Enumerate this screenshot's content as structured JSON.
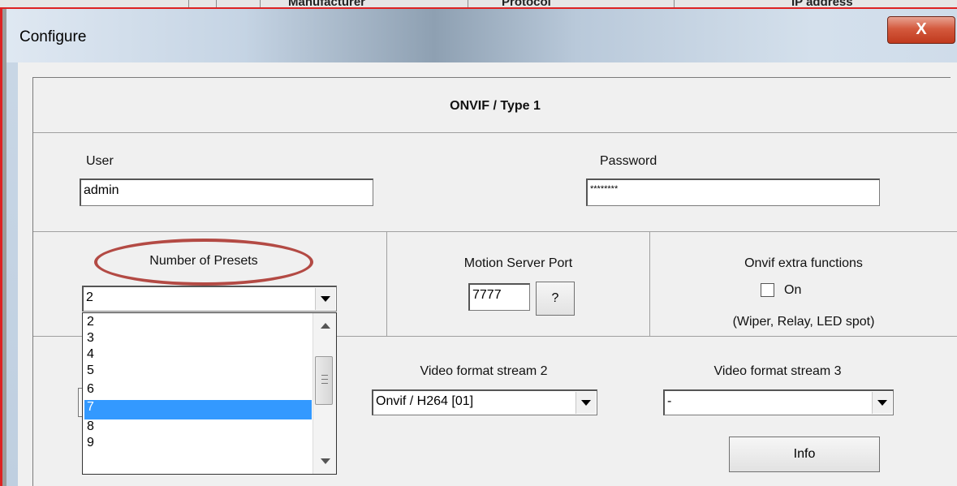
{
  "background_app": {
    "columns": [
      "Manufacturer",
      "Protocol",
      "IP address"
    ]
  },
  "dialog": {
    "title": "Configure",
    "close_label": "X",
    "section_title": "ONVIF / Type 1",
    "user": {
      "label": "User",
      "value": "admin"
    },
    "password": {
      "label": "Password",
      "value": "********"
    },
    "presets": {
      "label": "Number of Presets",
      "selected": "2",
      "options": [
        "2",
        "3",
        "4",
        "5",
        "6",
        "7",
        "8",
        "9"
      ],
      "highlighted": "7"
    },
    "motion_server": {
      "label": "Motion Server Port",
      "value": "7777",
      "help_label": "?"
    },
    "onvif_extra": {
      "label": "Onvif extra functions",
      "checkbox_label": "On",
      "checked": false,
      "note": "(Wiper, Relay, LED spot)"
    },
    "stream2": {
      "label": "Video format stream 2",
      "selected": "Onvif / H264  [01]"
    },
    "stream3": {
      "label": "Video format stream 3",
      "selected": "-"
    },
    "info_button": "Info"
  },
  "colors": {
    "highlight": "#3399ff",
    "annotation": "#b34a44",
    "close_button": "#c0391d"
  }
}
